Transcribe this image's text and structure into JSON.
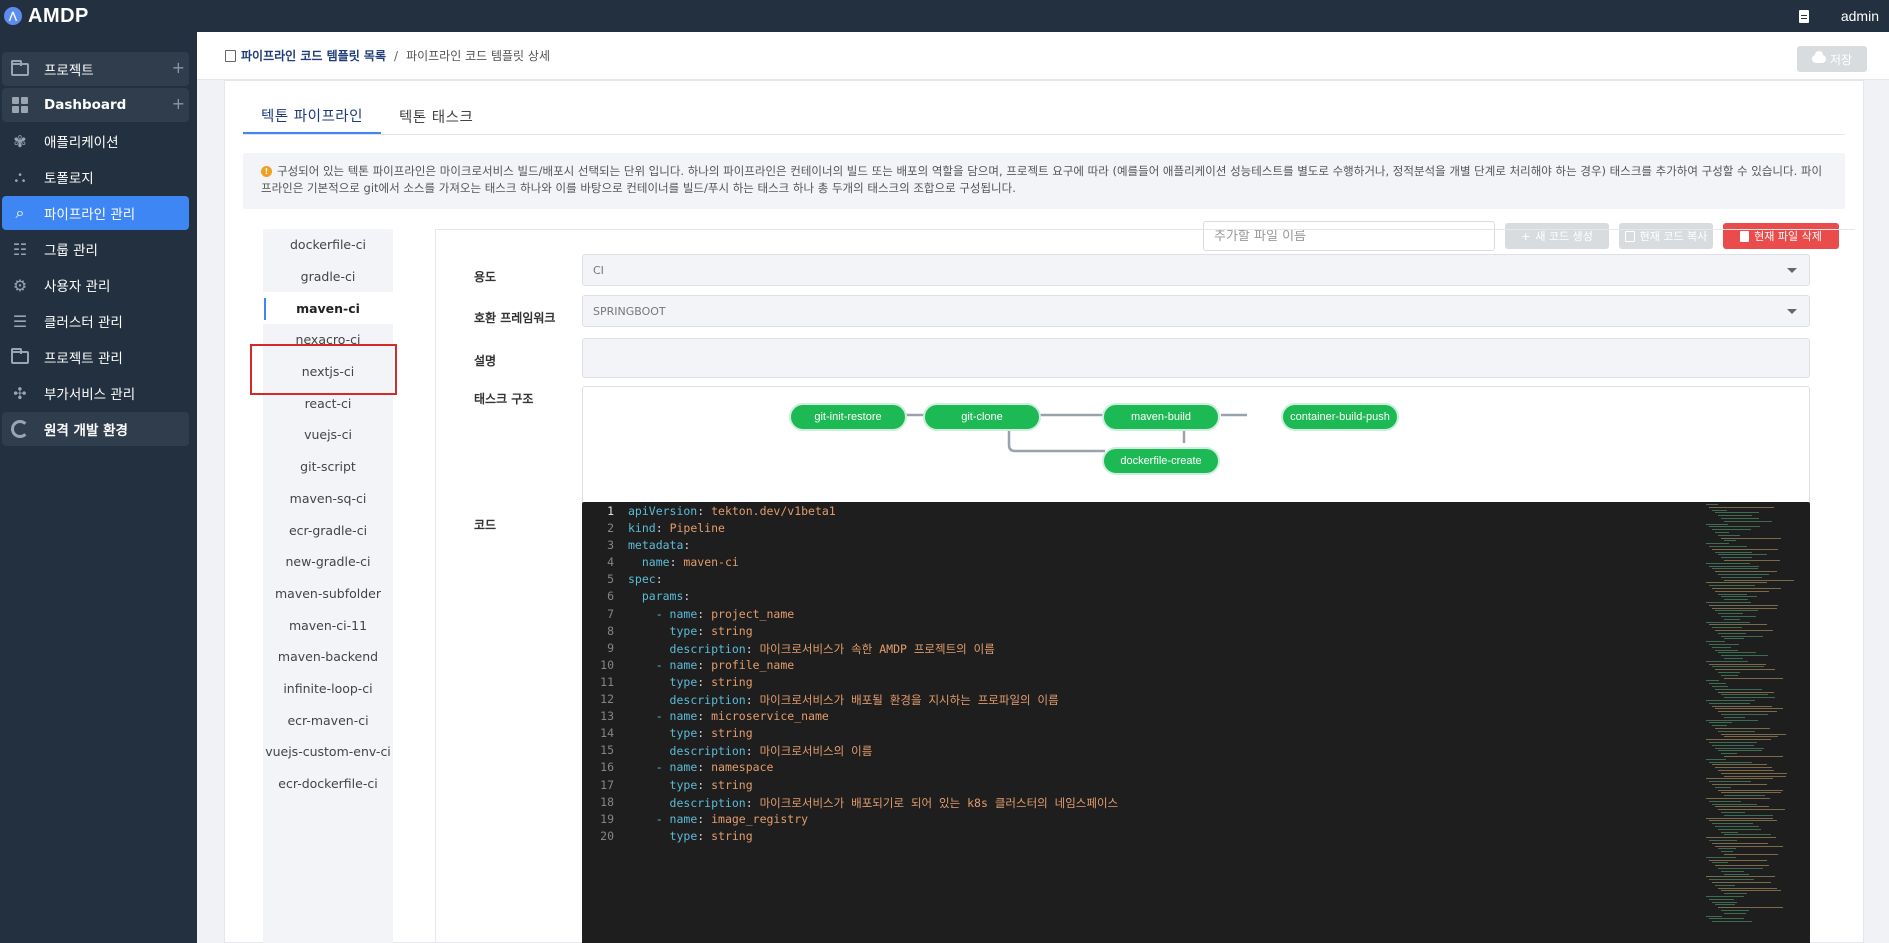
{
  "app": {
    "name": "AMDP",
    "user": "admin"
  },
  "sidebar": {
    "items": [
      {
        "label": "프로젝트",
        "icon": "folder-icon",
        "has_plus": true
      },
      {
        "label": "Dashboard",
        "icon": "dashboard-icon",
        "has_plus": true
      },
      {
        "label": "애플리케이션",
        "icon": "application-icon"
      },
      {
        "label": "토폴로지",
        "icon": "topology-icon"
      },
      {
        "label": "파이프라인 관리",
        "icon": "pipeline-icon",
        "active": true
      },
      {
        "label": "그룹 관리",
        "icon": "group-icon"
      },
      {
        "label": "사용자 관리",
        "icon": "user-settings-icon"
      },
      {
        "label": "클러스터 관리",
        "icon": "cluster-icon"
      },
      {
        "label": "프로젝트 관리",
        "icon": "folder-icon"
      },
      {
        "label": "부가서비스 관리",
        "icon": "puzzle-icon"
      },
      {
        "label": "원격 개발 환경",
        "icon": "remote-env-icon"
      }
    ],
    "plus_symbol": "+"
  },
  "breadcrumb": {
    "link": "파이프라인 코드 템플릿 목록",
    "separator": "/",
    "current": "파이프라인 코드 템플릿 상세"
  },
  "toolbar": {
    "save_label": "저장"
  },
  "tabs": [
    {
      "label": "텍톤 파이프라인",
      "active": true
    },
    {
      "label": "텍톤 태스크",
      "active": false
    }
  ],
  "notice": {
    "icon": "!",
    "text": "구성되어 있는 텍톤 파이프라인은 마이크로서비스 빌드/배포시 선택되는 단위 입니다. 하나의 파이프라인은 컨테이너의 빌드 또는 배포의 역할을 담으며, 프로젝트 요구에 따라 (예를들어 애플리케이션 성능테스트를 별도로 수행하거나, 정적분석을 개별 단계로 처리해야 하는 경우) 태스크를 추가하여 구성할 수 있습니다. 파이프라인은 기본적으로 git에서 소스를 가져오는 태스크 하나와 이를 바탕으로 컨테이너를 빌드/푸시 하는 태스크 하나 총 두개의 태스크의 조합으로 구성됩니다."
  },
  "file_actions": {
    "filename_placeholder": "추가할 파일 이름",
    "new_code_label": "새 코드 생성",
    "copy_label": "현재 코드 복사",
    "delete_label": "현재 파일 삭제"
  },
  "templates": [
    "dockerfile-ci",
    "gradle-ci",
    "maven-ci",
    "nexacro-ci",
    "nextjs-ci",
    "react-ci",
    "vuejs-ci",
    "git-script",
    "maven-sq-ci",
    "ecr-gradle-ci",
    "new-gradle-ci",
    "maven-subfolder",
    "maven-ci-11",
    "maven-backend",
    "infinite-loop-ci",
    "ecr-maven-ci",
    "vuejs-custom-env-ci",
    "ecr-dockerfile-ci"
  ],
  "selected_template": "maven-ci",
  "form": {
    "usage_label": "용도",
    "usage_value": "CI",
    "framework_label": "호환 프레임워크",
    "framework_value": "SPRINGBOOT",
    "description_label": "설명",
    "description_value": "",
    "task_structure_label": "태스크 구조",
    "code_label": "코드"
  },
  "task_nodes": [
    {
      "label": "git-init-restore"
    },
    {
      "label": "git-clone"
    },
    {
      "label": "maven-build"
    },
    {
      "label": "container-build-push"
    },
    {
      "label": "dockerfile-create"
    }
  ],
  "code_lines": [
    {
      "n": "1",
      "indent": "",
      "key": "apiVersion",
      "value": "tekton.dev/v1beta1"
    },
    {
      "n": "2",
      "indent": "",
      "key": "kind",
      "value": "Pipeline"
    },
    {
      "n": "3",
      "indent": "",
      "key": "metadata",
      "value": ""
    },
    {
      "n": "4",
      "indent": "  ",
      "key": "name",
      "value": "maven-ci"
    },
    {
      "n": "5",
      "indent": "",
      "key": "spec",
      "value": ""
    },
    {
      "n": "6",
      "indent": "  ",
      "key": "params",
      "value": ""
    },
    {
      "n": "7",
      "indent": "    - ",
      "key": "name",
      "value": "project_name"
    },
    {
      "n": "8",
      "indent": "      ",
      "key": "type",
      "value": "string"
    },
    {
      "n": "9",
      "indent": "      ",
      "key": "description",
      "value": "마이크로서비스가 속한 AMDP 프로젝트의 이름"
    },
    {
      "n": "10",
      "indent": "    - ",
      "key": "name",
      "value": "profile_name"
    },
    {
      "n": "11",
      "indent": "      ",
      "key": "type",
      "value": "string"
    },
    {
      "n": "12",
      "indent": "      ",
      "key": "description",
      "value": "마이크로서비스가 배포될 환경을 지시하는 프로파일의 이름"
    },
    {
      "n": "13",
      "indent": "    - ",
      "key": "name",
      "value": "microservice_name"
    },
    {
      "n": "14",
      "indent": "      ",
      "key": "type",
      "value": "string"
    },
    {
      "n": "15",
      "indent": "      ",
      "key": "description",
      "value": "마이크로서비스의 이름"
    },
    {
      "n": "16",
      "indent": "    - ",
      "key": "name",
      "value": "namespace"
    },
    {
      "n": "17",
      "indent": "      ",
      "key": "type",
      "value": "string"
    },
    {
      "n": "18",
      "indent": "      ",
      "key": "description",
      "value": "마이크로서비스가 배포되기로 되어 있는 k8s 클러스터의 네임스페이스"
    },
    {
      "n": "19",
      "indent": "    - ",
      "key": "name",
      "value": "image_registry"
    },
    {
      "n": "20",
      "indent": "      ",
      "key": "type",
      "value": "string"
    }
  ],
  "colors": {
    "sidebar_bg": "#22303f",
    "accent": "#3d86f4",
    "node_green": "#1db954",
    "danger": "#ea4c4c",
    "highlight_border": "#d42a2a"
  }
}
